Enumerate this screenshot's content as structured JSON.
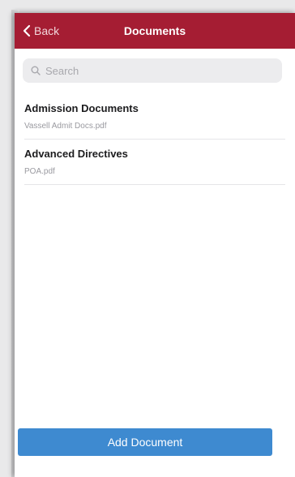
{
  "navbar": {
    "back_label": "Back",
    "title": "Documents",
    "color": "#a51d33"
  },
  "search": {
    "placeholder": "Search",
    "value": ""
  },
  "documents": [
    {
      "title": "Admission Documents",
      "file": "Vassell Admit Docs.pdf"
    },
    {
      "title": "Advanced Directives",
      "file": "POA.pdf"
    }
  ],
  "actions": {
    "add_document_label": "Add Document",
    "accent": "#3e8ad0"
  },
  "icons": {
    "back": "chevron-left-icon",
    "search": "search-icon"
  }
}
